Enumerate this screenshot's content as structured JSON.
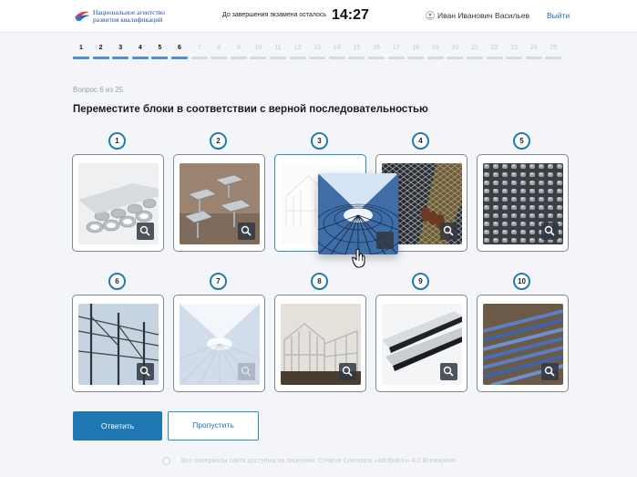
{
  "header": {
    "org_line1": "Национальное агентство",
    "org_line2": "развития квалификаций",
    "timer_label": "До завершения экзамена осталось",
    "timer": "14:27",
    "user_name": "Иван Иванович Васильев",
    "logout": "Выйти"
  },
  "steps": [
    "1",
    "2",
    "3",
    "4",
    "5",
    "6",
    "7",
    "8",
    "9",
    "10",
    "11",
    "12",
    "13",
    "14",
    "15",
    "16",
    "17",
    "18",
    "19",
    "20",
    "21",
    "22",
    "23",
    "24",
    "25"
  ],
  "completed_steps": 6,
  "question": {
    "counter": "Вопрос 6 из 25",
    "title": "Переместите блоки в соответствии с верной последовательностью"
  },
  "cards": [
    {
      "n": "1",
      "image": "steel-pipes"
    },
    {
      "n": "2",
      "image": "anchor-plates"
    },
    {
      "n": "3",
      "image": "frame-building",
      "state": "drop-target"
    },
    {
      "n": "4",
      "image": "metal-mesh"
    },
    {
      "n": "5",
      "image": "metal-pellets"
    },
    {
      "n": "6",
      "image": "steel-structure"
    },
    {
      "n": "7",
      "image": "glass-dome",
      "state": "dragged-placeholder"
    },
    {
      "n": "8",
      "image": "house-frame"
    },
    {
      "n": "9",
      "image": "metal-sheets"
    },
    {
      "n": "10",
      "image": "rebar"
    }
  ],
  "icons": {
    "zoom": "zoom-icon",
    "user": "user-icon",
    "drag_cursor": "hand-cursor-icon"
  },
  "buttons": {
    "answer": "Ответить",
    "skip": "Пропустить"
  },
  "footer": "Все материалы сайта доступны по лицензии: Creative Commons «Attribution» 4.0 Всемирная",
  "colors": {
    "accent": "#1f77b3",
    "progress": "#4f8ed6",
    "badge_border": "#1f7bb0"
  }
}
